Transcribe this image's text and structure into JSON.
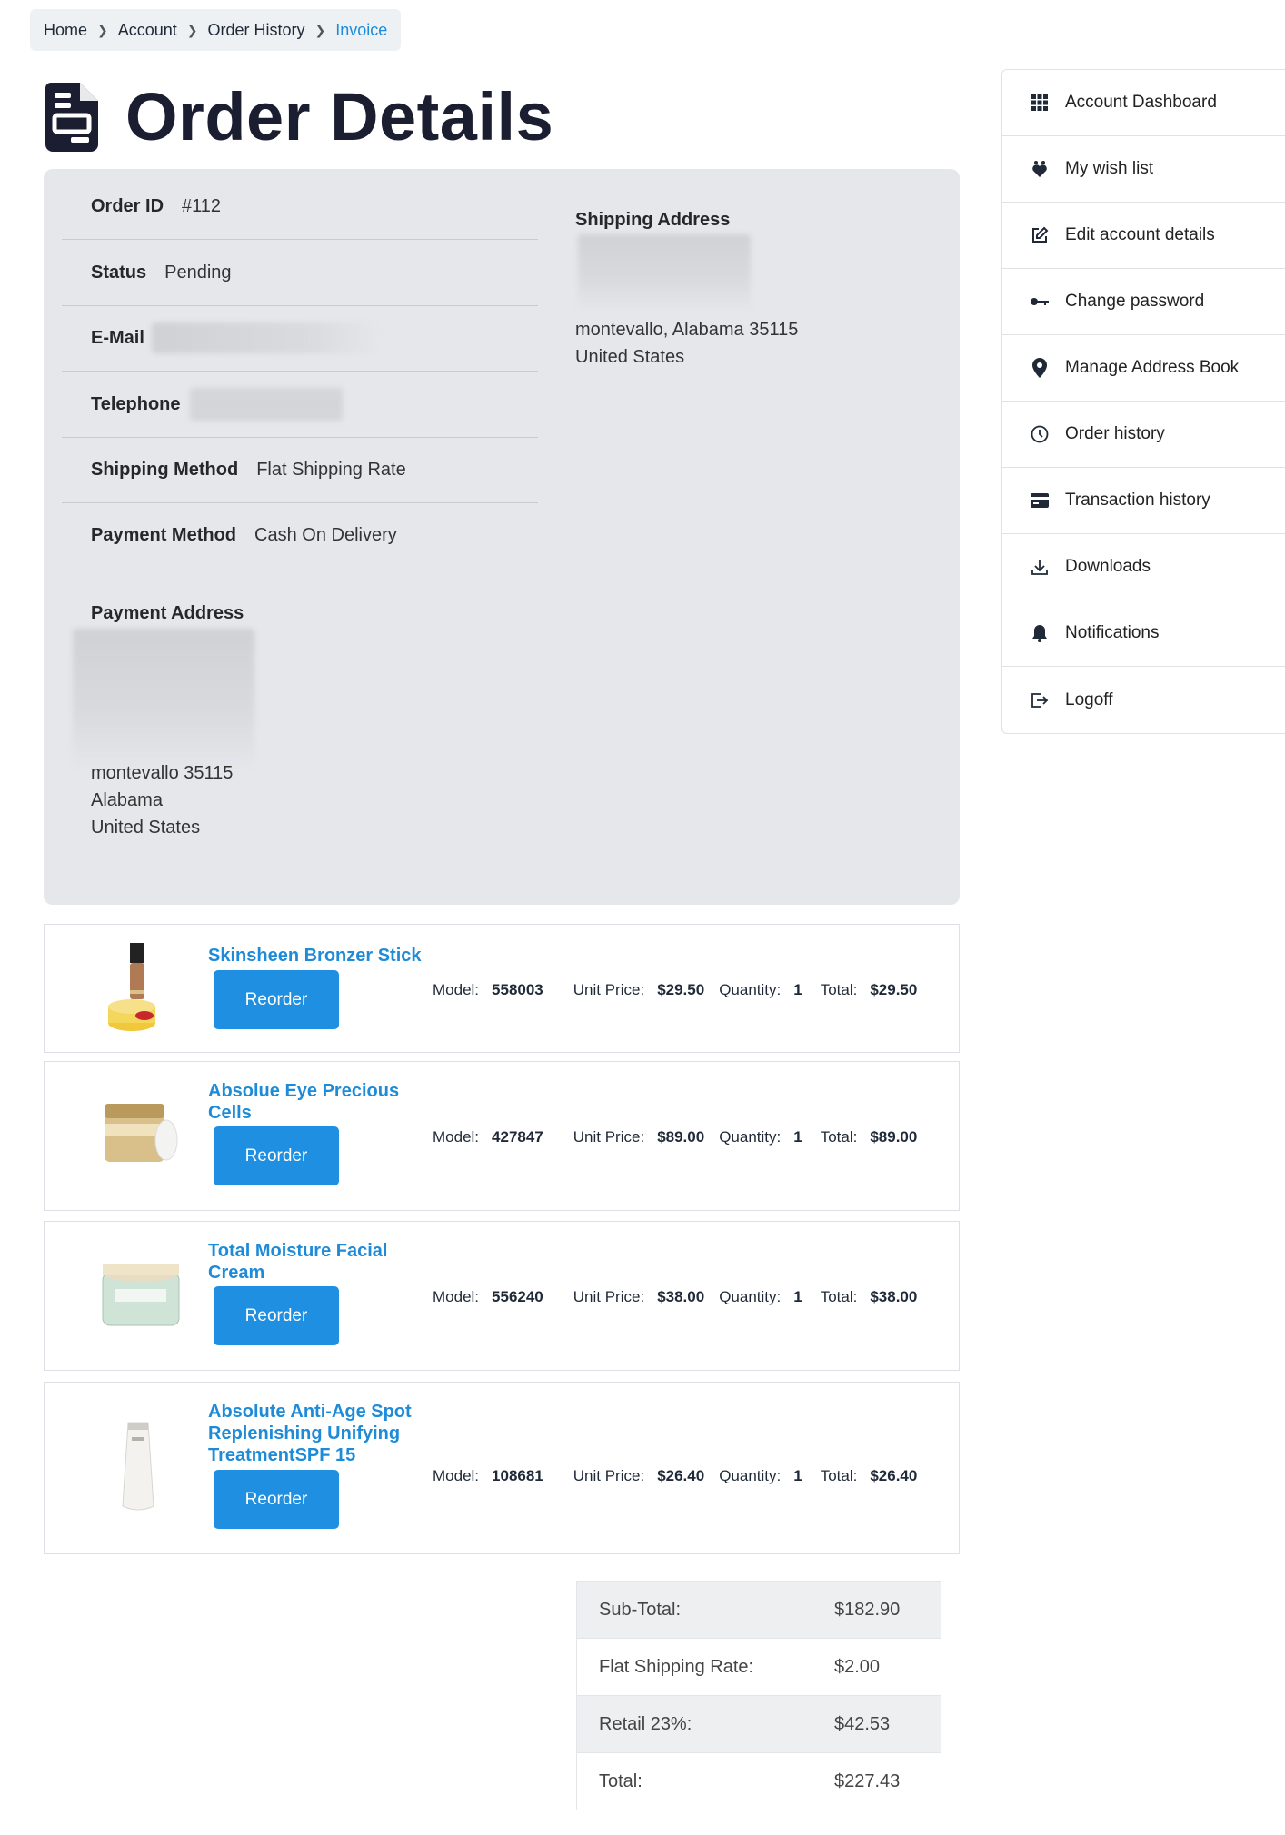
{
  "breadcrumb": [
    "Home",
    "Account",
    "Order History",
    "Invoice"
  ],
  "page_title": "Order Details",
  "order": {
    "order_id_label": "Order ID",
    "order_id": "#112",
    "status_label": "Status",
    "status": "Pending",
    "email_label": "E-Mail",
    "telephone_label": "Telephone",
    "shipping_method_label": "Shipping Method",
    "shipping_method": "Flat Shipping Rate",
    "payment_method_label": "Payment Method",
    "payment_method": "Cash On Delivery",
    "payment_address_label": "Payment Address",
    "payment_address_lines": [
      "montevallo 35115",
      "Alabama",
      "United States"
    ],
    "shipping_address_label": "Shipping Address",
    "shipping_address_lines": [
      "montevallo, Alabama 35115",
      "United States"
    ]
  },
  "labels": {
    "model": "Model:",
    "unit_price": "Unit Price:",
    "quantity": "Quantity:",
    "total": "Total:",
    "reorder": "Reorder"
  },
  "products": [
    {
      "name": "Skinsheen Bronzer Stick",
      "model": "558003",
      "unit_price": "$29.50",
      "quantity": "1",
      "total": "$29.50"
    },
    {
      "name": "Absolue Eye Precious Cells",
      "model": "427847",
      "unit_price": "$89.00",
      "quantity": "1",
      "total": "$89.00"
    },
    {
      "name": "Total Moisture Facial Cream",
      "model": "556240",
      "unit_price": "$38.00",
      "quantity": "1",
      "total": "$38.00"
    },
    {
      "name": "Absolute Anti-Age Spot Replenishing Unifying TreatmentSPF 15",
      "model": "108681",
      "unit_price": "$26.40",
      "quantity": "1",
      "total": "$26.40"
    }
  ],
  "totals": [
    {
      "label": "Sub-Total:",
      "amount": "$182.90"
    },
    {
      "label": "Flat Shipping Rate:",
      "amount": "$2.00"
    },
    {
      "label": "Retail 23%:",
      "amount": "$42.53"
    },
    {
      "label": "Total:",
      "amount": "$227.43"
    }
  ],
  "sidebar": [
    {
      "label": "Account Dashboard",
      "icon": "grid-icon"
    },
    {
      "label": "My wish list",
      "icon": "heart-icon"
    },
    {
      "label": "Edit account details",
      "icon": "edit-icon"
    },
    {
      "label": "Change password",
      "icon": "key-icon"
    },
    {
      "label": "Manage Address Book",
      "icon": "map-pin-icon"
    },
    {
      "label": "Order history",
      "icon": "clock-icon"
    },
    {
      "label": "Transaction history",
      "icon": "credit-card-icon"
    },
    {
      "label": "Downloads",
      "icon": "download-icon"
    },
    {
      "label": "Notifications",
      "icon": "bell-icon"
    },
    {
      "label": "Logoff",
      "icon": "logout-icon"
    }
  ]
}
